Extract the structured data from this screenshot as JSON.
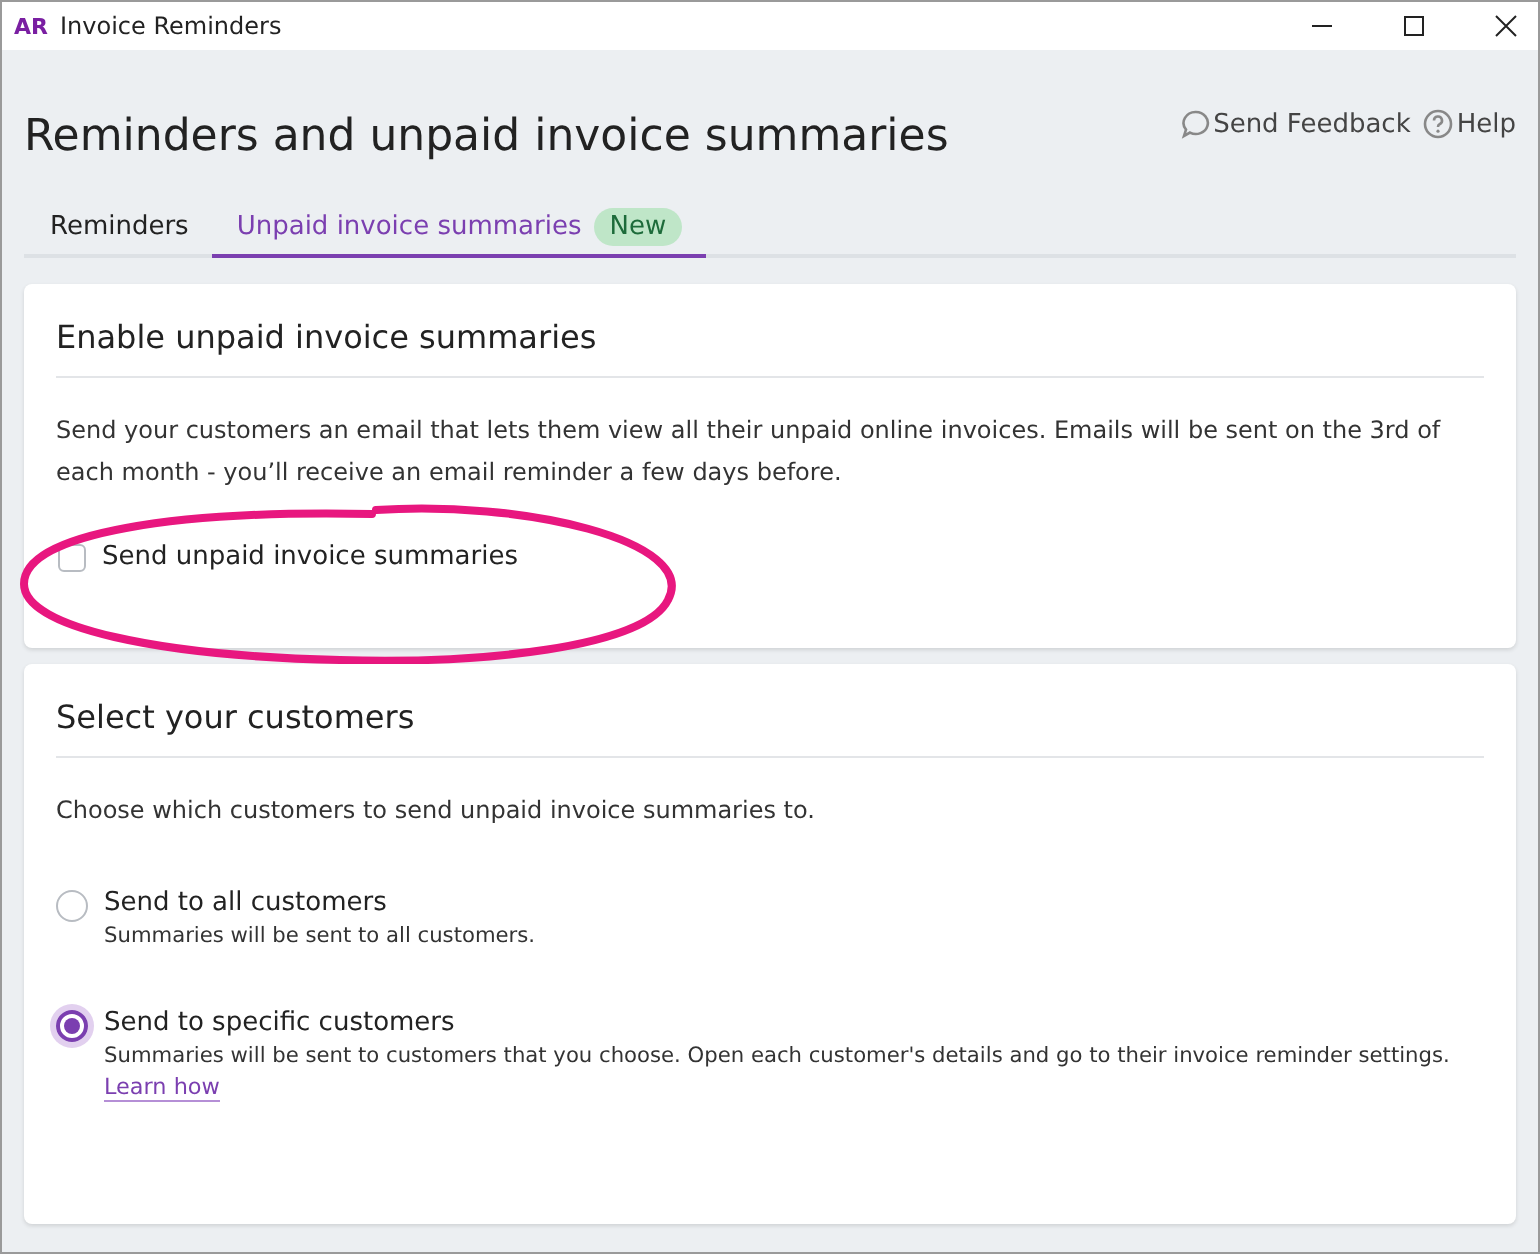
{
  "window": {
    "logo": "AR",
    "title": "Invoice Reminders"
  },
  "header": {
    "title": "Reminders and unpaid invoice summaries",
    "links": [
      {
        "kind": "feedback",
        "label": "Send Feedback"
      },
      {
        "kind": "help",
        "label": "Help"
      }
    ]
  },
  "tabs": [
    {
      "label": "Reminders",
      "selected": false
    },
    {
      "label": "Unpaid invoice summaries",
      "selected": true,
      "badge": "New"
    }
  ],
  "enable_card": {
    "title": "Enable unpaid invoice summaries",
    "description": "Send your customers an email that lets them view all their unpaid online invoices. Emails will be sent on the 3rd of each month - you’ll receive an email reminder a few days before.",
    "checkbox": {
      "label": "Send unpaid invoice summaries",
      "checked": false
    }
  },
  "customers_card": {
    "title": "Select your customers",
    "description": "Choose which customers to send unpaid invoice summaries to.",
    "options": [
      {
        "label": "Send to all customers",
        "hint": "Summaries will be sent to all customers.",
        "selected": false
      },
      {
        "label": "Send to specific customers",
        "hint": "Summaries will be sent to customers that you choose. Open each customer's details and go to their invoice reminder settings.",
        "link": "Learn how",
        "selected": true
      }
    ]
  }
}
